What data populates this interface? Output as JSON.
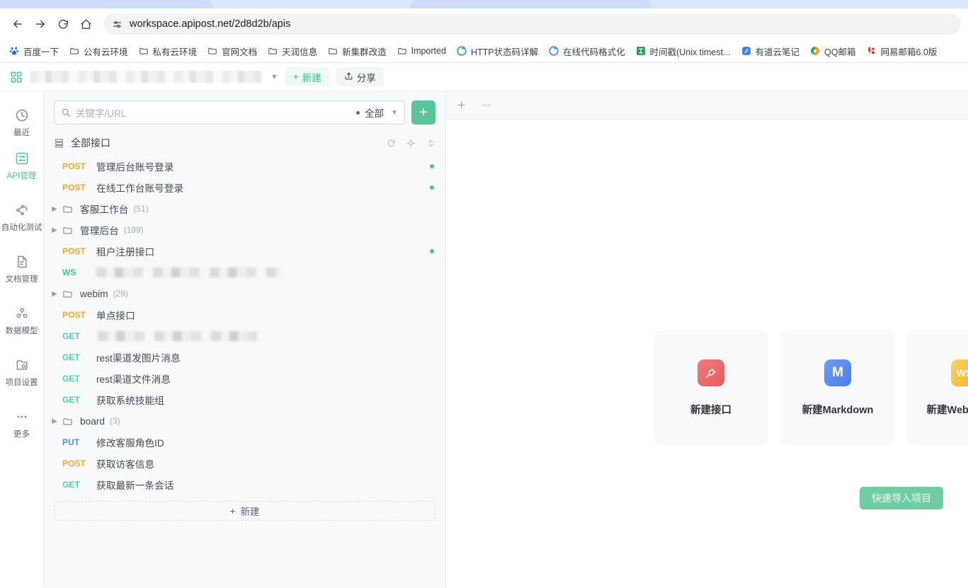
{
  "browser": {
    "url": "workspace.apipost.net/2d8d2b/apis",
    "nav": {
      "back": "back-arrow",
      "forward": "forward-arrow",
      "reload": "reload",
      "home": "home"
    },
    "site_settings_icon": "site-settings-icon",
    "bookmarks": [
      {
        "label": "百度一下",
        "icon": "baidu-paw-icon",
        "color": "#2a6edb"
      },
      {
        "label": "公有云环境",
        "icon": "folder-icon",
        "color": "#5f6368"
      },
      {
        "label": "私有云环境",
        "icon": "folder-icon",
        "color": "#5f6368"
      },
      {
        "label": "官网文档",
        "icon": "folder-icon",
        "color": "#5f6368"
      },
      {
        "label": "天润信息",
        "icon": "folder-icon",
        "color": "#5f6368"
      },
      {
        "label": "新集群改造",
        "icon": "folder-icon",
        "color": "#5f6368"
      },
      {
        "label": "Imported",
        "icon": "folder-icon",
        "color": "#5f6368"
      },
      {
        "label": "HTTP状态码详解",
        "icon": "chrome-circle-icon",
        "color": "#4a90e2"
      },
      {
        "label": "在线代码格式化",
        "icon": "chrome-circle-icon",
        "color": "#4a90e2"
      },
      {
        "label": "时间戳(Unix timest...",
        "icon": "tool-square-icon",
        "color": "#1f9d55"
      },
      {
        "label": "有道云笔记",
        "icon": "youdao-icon",
        "color": "#3f7fe8"
      },
      {
        "label": "QQ邮箱",
        "icon": "qq-mail-icon",
        "color": "#ef9a1e"
      },
      {
        "label": "网易邮箱6.0版",
        "icon": "netease-mail-icon",
        "color": "#d93025"
      }
    ]
  },
  "workspace": {
    "apps_icon": "apps-grid-icon",
    "name_redacted": true,
    "dropdown_chevron": "chevron-down-icon",
    "new_label": "新建",
    "share_label": "分享"
  },
  "rail": {
    "items": [
      {
        "label": "最近",
        "icon": "clock-history-icon",
        "active": false
      },
      {
        "label": "API管理",
        "icon": "api-sliders-icon",
        "active": true
      },
      {
        "label": "自动化测试",
        "icon": "automation-nodes-icon",
        "active": false
      },
      {
        "label": "文档管理",
        "icon": "document-icon",
        "active": false
      },
      {
        "label": "数据模型",
        "icon": "data-model-icon",
        "active": false
      },
      {
        "label": "项目设置",
        "icon": "project-settings-icon",
        "active": false
      },
      {
        "label": "更多",
        "icon": "more-dots-icon",
        "active": false
      }
    ]
  },
  "panel": {
    "search": {
      "placeholder": "关键字/URL",
      "value": "",
      "filter_label": "全部",
      "search_icon": "search-icon",
      "chevron": "chevron-down-icon"
    },
    "add_button": "+",
    "group": {
      "label": "全部接口",
      "icon": "list-tree-icon",
      "actions": [
        {
          "name": "refresh-icon"
        },
        {
          "name": "locate-target-icon"
        },
        {
          "name": "sort-icon"
        }
      ]
    },
    "rows": [
      {
        "kind": "api",
        "method": "POST",
        "name": "管理后台账号登录",
        "dot": true,
        "redacted": false
      },
      {
        "kind": "api",
        "method": "POST",
        "name": "在线工作台账号登录",
        "dot": true,
        "redacted": false
      },
      {
        "kind": "folder",
        "name": "客服工作台",
        "count": "(51)"
      },
      {
        "kind": "folder",
        "name": "管理后台",
        "count": "(199)"
      },
      {
        "kind": "api",
        "method": "POST",
        "name": "租户注册接口",
        "dot": true,
        "redacted": false
      },
      {
        "kind": "api",
        "method": "WS",
        "name": "",
        "dot": false,
        "redacted": true
      },
      {
        "kind": "folder",
        "name": "webim",
        "count": "(29)"
      },
      {
        "kind": "api",
        "method": "POST",
        "name": "单点接口",
        "dot": false,
        "redacted": false
      },
      {
        "kind": "api",
        "method": "GET",
        "name": "",
        "dot": false,
        "redacted": true
      },
      {
        "kind": "api",
        "method": "GET",
        "name": "rest渠道发图片消息",
        "dot": false,
        "redacted": false
      },
      {
        "kind": "api",
        "method": "GET",
        "name": "rest渠道文件消息",
        "dot": false,
        "redacted": false
      },
      {
        "kind": "api",
        "method": "GET",
        "name": "获取系统技能组",
        "dot": false,
        "redacted": false
      },
      {
        "kind": "folder",
        "name": "board",
        "count": "(3)"
      },
      {
        "kind": "api",
        "method": "PUT",
        "name": "修改客服角色ID",
        "dot": false,
        "redacted": false
      },
      {
        "kind": "api",
        "method": "POST",
        "name": "获取访客信息",
        "dot": false,
        "redacted": false
      },
      {
        "kind": "api",
        "method": "GET",
        "name": "获取最新一条会话",
        "dot": false,
        "redacted": false
      }
    ],
    "new_row_label": "新建"
  },
  "main": {
    "tabbar": {
      "add_icon": "plus-icon",
      "more_icon": "ellipsis-icon"
    },
    "cards": [
      {
        "label": "新建接口",
        "icon": "api-plug-icon",
        "icon_text": "",
        "bg": "#ef6a6a"
      },
      {
        "label": "新建Markdown",
        "icon": "markdown-icon",
        "icon_text": "M",
        "bg": "#5b8def"
      },
      {
        "label": "新建WebSocket",
        "icon": "websocket-icon",
        "icon_text": "WS",
        "bg": "#f5c13b"
      }
    ],
    "import_button": "快速导入项目"
  },
  "colors": {
    "method_post": "#f5a623",
    "method_get": "#4cd3a5",
    "method_put": "#4a90e2",
    "method_ws": "#3fc79a",
    "accent_green": "#4cc38a",
    "dot_green": "#4cc38a"
  }
}
